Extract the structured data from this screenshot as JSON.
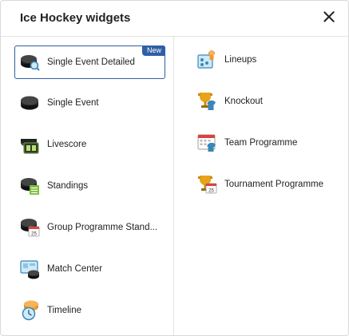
{
  "dialog": {
    "title": "Ice Hockey widgets",
    "close_icon": "close-icon"
  },
  "colors": {
    "accent": "#2f5fa5",
    "puck": "#1f1f1f",
    "trophy": "#e8a317"
  },
  "left_items": [
    {
      "label": "Single Event Detailed",
      "icon": "puck-magnifier-icon",
      "badge": "New",
      "selected": true
    },
    {
      "label": "Single Event",
      "icon": "puck-icon"
    },
    {
      "label": "Livescore",
      "icon": "puck-scoreboard-icon"
    },
    {
      "label": "Standings",
      "icon": "puck-table-icon"
    },
    {
      "label": "Group Programme Stand...",
      "icon": "puck-calendar-icon"
    },
    {
      "label": "Match Center",
      "icon": "monitor-puck-icon"
    },
    {
      "label": "Timeline",
      "icon": "puck-clock-icon"
    }
  ],
  "right_items": [
    {
      "label": "Lineups",
      "icon": "lineup-board-icon"
    },
    {
      "label": "Knockout",
      "icon": "trophy-jersey-icon"
    },
    {
      "label": "Team Programme",
      "icon": "calendar-jersey-icon"
    },
    {
      "label": "Tournament Programme",
      "icon": "trophy-calendar-icon"
    }
  ]
}
